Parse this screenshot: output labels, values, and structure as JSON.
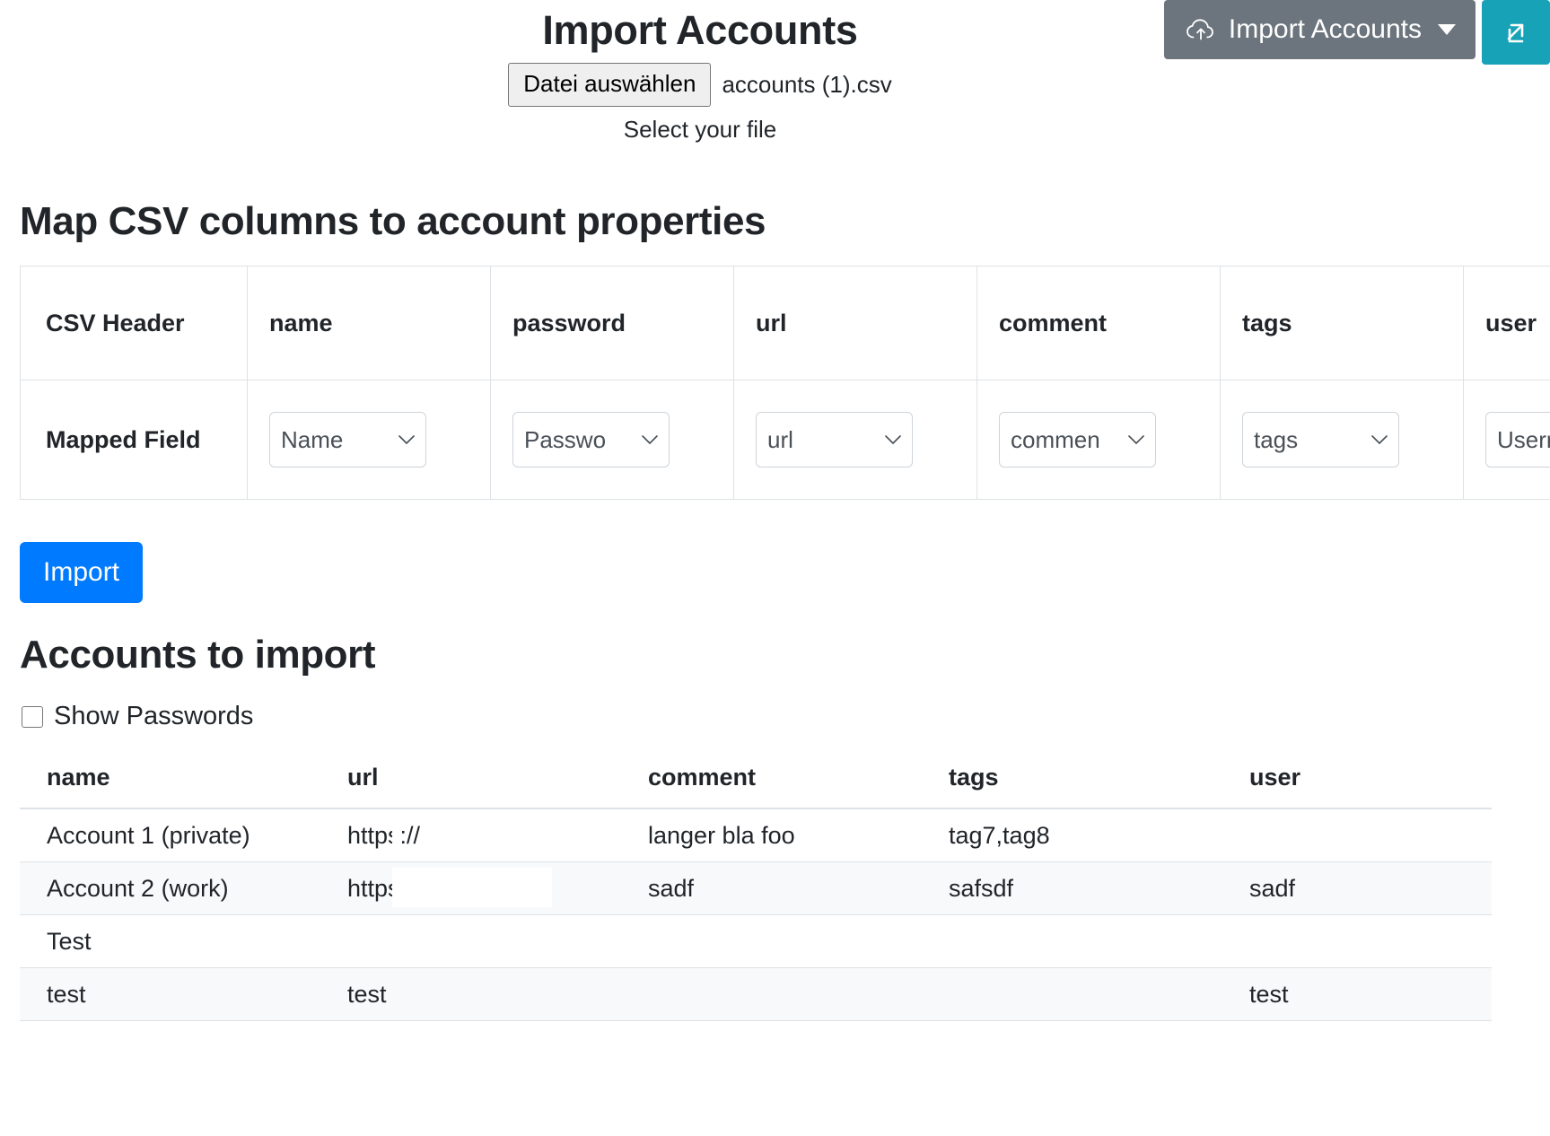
{
  "topbar": {
    "import_accounts_label": "Import Accounts",
    "import_accounts_icon": "cloud-upload-icon",
    "caret_icon": "caret-down-icon",
    "popout_icon": "external-link-icon",
    "button_bg": "#6c757d",
    "popout_bg": "#17a2b8"
  },
  "header": {
    "title": "Import Accounts",
    "file_button_label": "Datei auswählen",
    "file_name": "accounts (1).csv",
    "hint": "Select your file"
  },
  "mapping": {
    "heading": "Map CSV columns to account properties",
    "row_labels": {
      "csv_header": "CSV Header",
      "mapped_field": "Mapped Field"
    },
    "csv_headers": [
      "name",
      "password",
      "url",
      "comment",
      "tags",
      "user"
    ],
    "mapped_fields": [
      "Name",
      "Passwo",
      "url",
      "commen",
      "tags",
      "Userna"
    ],
    "chevron_icon": "chevron-down-icon"
  },
  "actions": {
    "import_label": "Import",
    "import_color": "#007bff"
  },
  "accounts_section": {
    "heading": "Accounts to import",
    "show_passwords_label": "Show Passwords",
    "show_passwords_checked": false,
    "columns": [
      "name",
      "url",
      "comment",
      "tags",
      "user"
    ],
    "rows": [
      {
        "name": "Account 1 (private)",
        "url": "https://",
        "comment": "langer bla foo",
        "tags": "tag7,tag8",
        "user": ""
      },
      {
        "name": "Account 2 (work)",
        "url": "https://",
        "comment": "sadf",
        "tags": "safsdf",
        "user": "sadf"
      },
      {
        "name": "Test",
        "url": "",
        "comment": "",
        "tags": "",
        "user": ""
      },
      {
        "name": "test",
        "url": "test",
        "comment": "",
        "tags": "",
        "user": "test"
      }
    ]
  }
}
